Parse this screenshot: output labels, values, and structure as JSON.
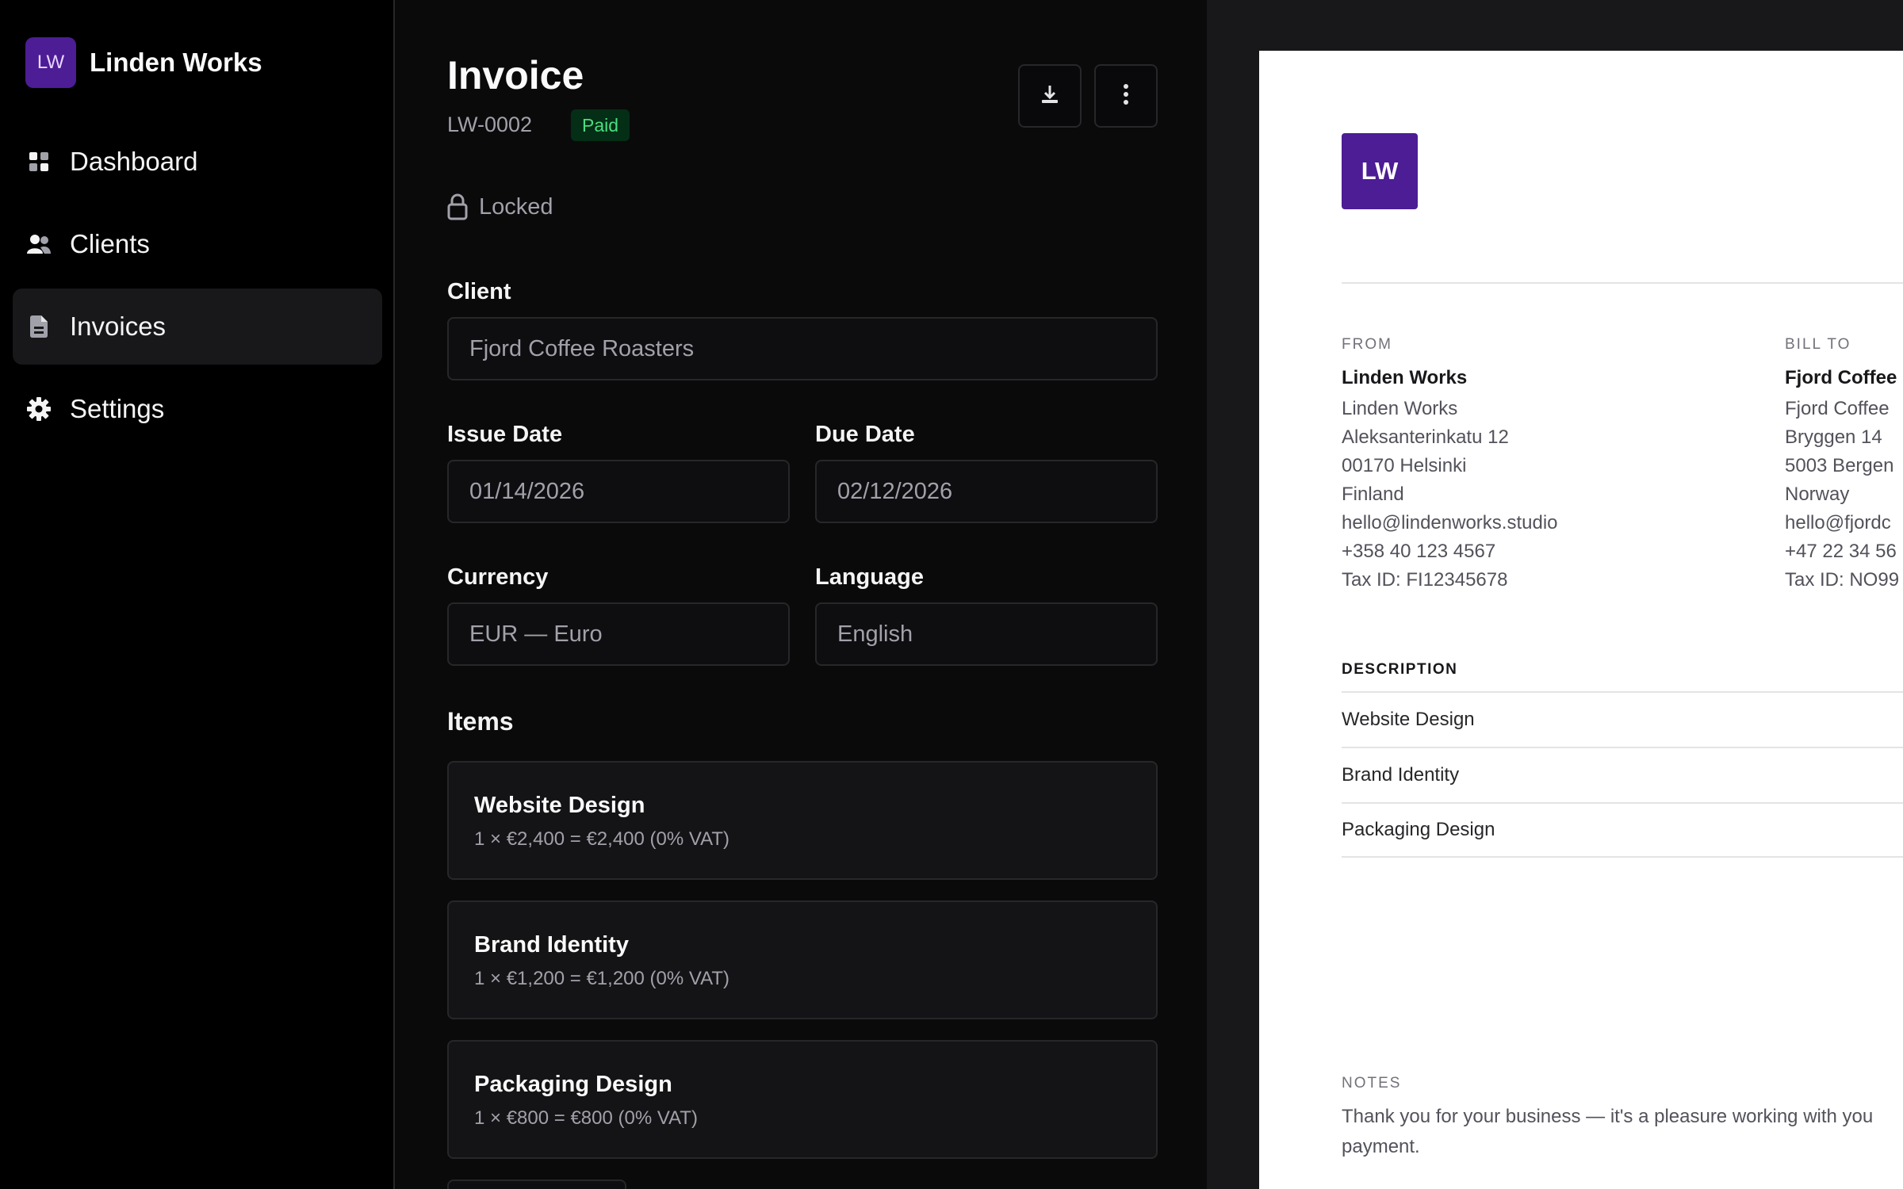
{
  "brand": {
    "initials": "LW",
    "name": "Linden Works"
  },
  "sidebar": {
    "items": [
      {
        "label": "Dashboard",
        "icon": "dashboard-icon"
      },
      {
        "label": "Clients",
        "icon": "users-icon"
      },
      {
        "label": "Invoices",
        "icon": "document-icon",
        "active": true
      },
      {
        "label": "Settings",
        "icon": "gear-icon"
      }
    ]
  },
  "invoice": {
    "title": "Invoice",
    "number": "LW-0002",
    "status": "Paid",
    "locked_label": "Locked",
    "actions": {
      "download_icon": "download-icon",
      "more_icon": "more-vertical-icon"
    }
  },
  "form": {
    "client": {
      "label": "Client",
      "value": "Fjord Coffee Roasters"
    },
    "issue_date": {
      "label": "Issue Date",
      "value": "01/14/2026"
    },
    "due_date": {
      "label": "Due Date",
      "value": "02/12/2026"
    },
    "currency": {
      "label": "Currency",
      "value": "EUR — Euro"
    },
    "language": {
      "label": "Language",
      "value": "English"
    }
  },
  "items": {
    "title": "Items",
    "list": [
      {
        "name": "Website Design",
        "calc": "1 × €2,400 = €2,400 (0% VAT)"
      },
      {
        "name": "Brand Identity",
        "calc": "1 × €1,200 = €1,200 (0% VAT)"
      },
      {
        "name": "Packaging Design",
        "calc": "1 × €800 = €800 (0% VAT)"
      }
    ]
  },
  "preview": {
    "logo": "LW",
    "from": {
      "caption": "FROM",
      "name": "Linden Works",
      "lines": [
        "Linden Works",
        "Aleksanterinkatu 12",
        "00170 Helsinki",
        "Finland",
        "hello@lindenworks.studio",
        "+358 40 123 4567",
        "Tax ID: FI12345678"
      ]
    },
    "bill_to": {
      "caption": "BILL TO",
      "name": "Fjord Coffee",
      "lines": [
        "Fjord Coffee",
        "Bryggen 14",
        "5003 Bergen",
        "Norway",
        "hello@fjordc",
        "+47 22 34 56",
        "Tax ID: NO99"
      ]
    },
    "description_header": "DESCRIPTION",
    "rows": [
      "Website Design",
      "Brand Identity",
      "Packaging Design"
    ],
    "notes": {
      "caption": "NOTES",
      "line1": "Thank you for your business — it's a pleasure working with you",
      "line2": "payment."
    }
  },
  "colors": {
    "accent": "#4c1d95",
    "paid_bg": "#052e16",
    "paid_text": "#4ade80"
  }
}
